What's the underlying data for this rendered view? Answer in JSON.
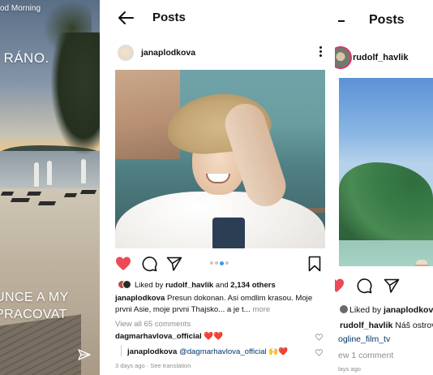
{
  "story": {
    "greeting": "od Morning",
    "headline": "I RÁNO.",
    "bottom_line1": "UNCE A MY",
    "bottom_line2": "PRACOVAT"
  },
  "post_screen": {
    "title": "Posts",
    "username": "janaplodkova",
    "liked_by_prefix": "Liked by ",
    "liked_by_user": "rudolf_havlik",
    "liked_by_and": " and ",
    "liked_by_count": "2,134 others",
    "caption_user": "janaplodkova",
    "caption_text": " Presun dokonan. Asi omdlim krasou. Moje prvni Asie, moje prvni Thajsko... a je t...",
    "caption_more": " more",
    "view_all": "View all 65 comments",
    "comment1_user": "dagmarhavlova_official",
    "comment1_text": " ❤️❤️",
    "comment2_user": "janaplodkova",
    "comment2_mention": " @dagmarhavlova_official",
    "comment2_text": " 🙌❤️",
    "meta": "3 days ago · See translation",
    "carousel_count": 4,
    "carousel_active": 3
  },
  "right_screen": {
    "title": "Posts",
    "username": "rudolf_havlik",
    "liked_by_prefix": "Liked by ",
    "liked_by_user": "janaplodkova",
    "caption_text": " Náš ostrov",
    "caption_tag": "ogline_film_tv",
    "comments": "ew 1 comment",
    "meta": "lays ago"
  },
  "colors": {
    "like_red": "#ed4956",
    "link_blue": "#00376b",
    "dot_blue": "#3897f0",
    "muted_gray": "#8e8e8e"
  },
  "icons": [
    "send-icon",
    "back-arrow-icon",
    "kebab-menu-icon",
    "heart-filled-icon",
    "comment-icon",
    "share-icon",
    "bookmark-icon",
    "heart-small-icon"
  ]
}
